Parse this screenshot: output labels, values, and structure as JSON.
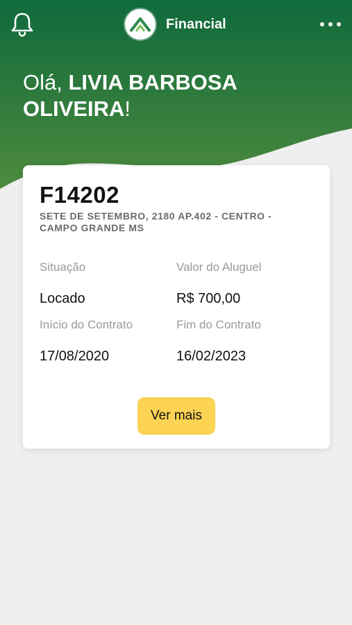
{
  "header": {
    "app_name": "Financial",
    "notification_icon": "bell-icon",
    "menu_icon": "more-dots-icon",
    "logo_icon": "roof-logo-icon"
  },
  "greeting": {
    "prefix": "Olá, ",
    "name": "LIVIA BARBOSA OLIVEIRA",
    "suffix": "!"
  },
  "property": {
    "code": "F14202",
    "address": "SETE DE SETEMBRO, 2180 AP.402 - CENTRO - CAMPO GRANDE MS",
    "situacao_label": "Situação",
    "situacao_value": "Locado",
    "aluguel_label": "Valor do Aluguel",
    "aluguel_value": "R$ 700,00",
    "inicio_label": "Início do Contrato",
    "inicio_value": "17/08/2020",
    "fim_label": "Fim do Contrato",
    "fim_value": "16/02/2023",
    "button_label": "Ver mais"
  },
  "colors": {
    "header_green_dark": "#0f6a3c",
    "header_green_light": "#4d8a3e",
    "button_yellow": "#fcd353",
    "background": "#efefef"
  }
}
